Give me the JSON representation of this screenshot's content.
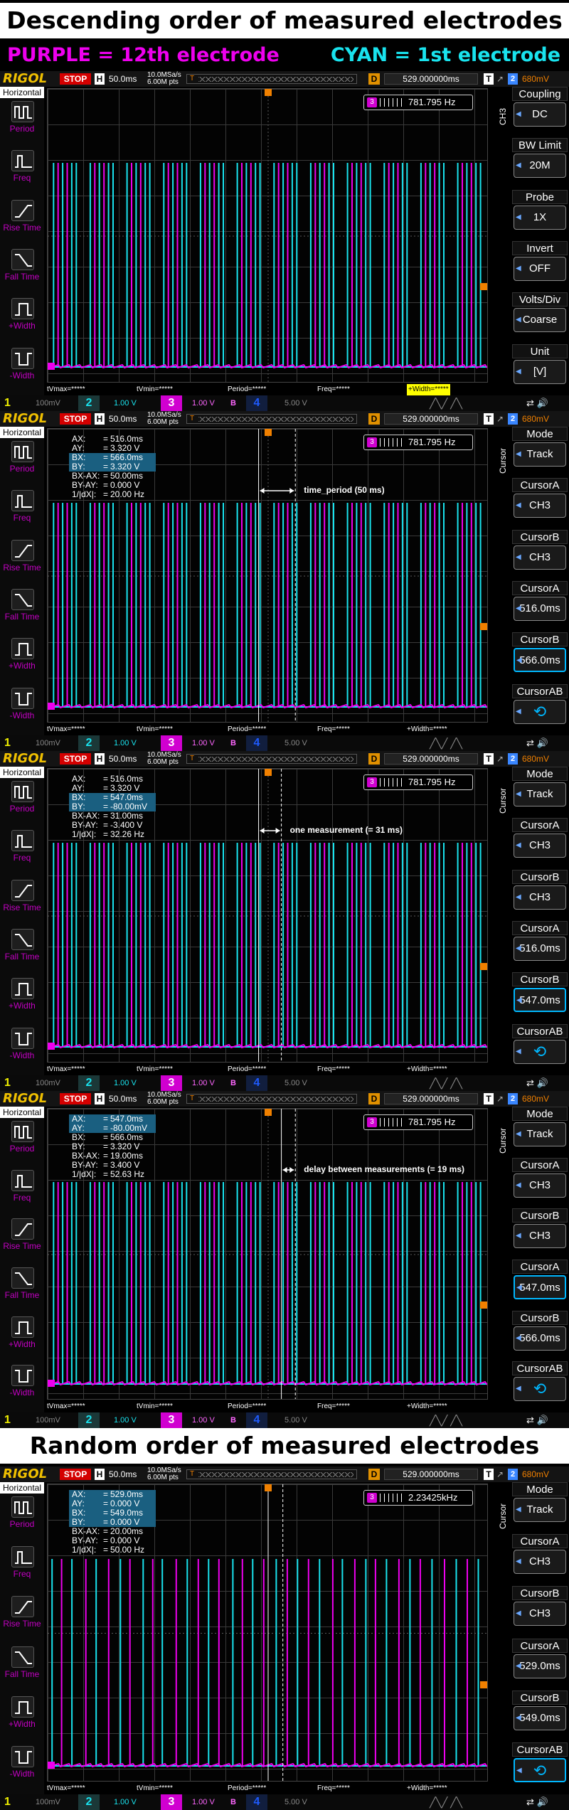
{
  "headings": {
    "descending": "Descending order of measured electrodes",
    "random": "Random order of measured electrodes"
  },
  "legend": {
    "purple": "PURPLE = 12th electrode",
    "cyan": "CYAN = 1st electrode"
  },
  "colors": {
    "purple": "#ee00ee",
    "cyan": "#19e3ee",
    "rigol_yellow": "#f0c000",
    "stop_red": "#d40000",
    "cursor_blue": "#00b8ff"
  },
  "scopes": [
    {
      "brand": "RIGOL",
      "run_state": "STOP",
      "h_label": "H",
      "timebase": "50.0ms",
      "sample_rate": "10.0MSa/s",
      "points": "6.00M pts",
      "trig_mark": "T",
      "d_label": "D",
      "delay": "529.000000ms",
      "t_label": "T",
      "trig_ch": "2",
      "trig_level": "680mV",
      "freq": "781.795 Hz",
      "freq_icon": "3",
      "left_menu": {
        "title": "Horizontal",
        "items": [
          "Period",
          "Freq",
          "Rise Time",
          "Fall Time",
          "+Width",
          "-Width"
        ]
      },
      "bottom_meas": [
        "tVmax=*****",
        "tVmin=*****",
        "Period=*****",
        "Freq=*****",
        "+Width=*****"
      ],
      "bottom_highlight": 4,
      "right_menu": {
        "vertical_label": "CH3",
        "items": [
          {
            "head": "Coupling",
            "value": "DC"
          },
          {
            "head": "BW Limit",
            "value": "20M"
          },
          {
            "head": "Probe",
            "value": "1X"
          },
          {
            "head": "Invert",
            "value": "OFF"
          },
          {
            "head": "Volts/Div",
            "value": "Coarse"
          },
          {
            "head": "Unit",
            "value": "[V]"
          }
        ]
      },
      "cursor_rows": [],
      "annotation": "",
      "cursor_a_t": null,
      "cursor_b_t": null,
      "channel_bar": {
        "ch1": "1",
        "ch1_val": "100mV",
        "ch2": "2",
        "ch2_val": "1.00 V",
        "ch3": "3",
        "ch3_val": "1.00 V",
        "bw": "B",
        "ch4": "4",
        "ch4_val": "5.00 V"
      },
      "pattern": "desc"
    },
    {
      "brand": "RIGOL",
      "run_state": "STOP",
      "h_label": "H",
      "timebase": "50.0ms",
      "sample_rate": "10.0MSa/s",
      "points": "6.00M pts",
      "trig_mark": "T",
      "d_label": "D",
      "delay": "529.000000ms",
      "t_label": "T",
      "trig_ch": "2",
      "trig_level": "680mV",
      "freq": "781.795 Hz",
      "freq_icon": "3",
      "left_menu": {
        "title": "Horizontal",
        "items": [
          "Period",
          "Freq",
          "Rise Time",
          "Fall Time",
          "+Width",
          "-Width"
        ]
      },
      "bottom_meas": [
        "tVmax=*****",
        "tVmin=*****",
        "Period=*****",
        "Freq=*****",
        "+Width=*****"
      ],
      "bottom_highlight": -1,
      "right_menu": {
        "vertical_label": "Cursor",
        "items": [
          {
            "head": "Mode",
            "value": "Track"
          },
          {
            "head": "CursorA",
            "value": "CH3"
          },
          {
            "head": "CursorB",
            "value": "CH3"
          },
          {
            "head": "CursorA",
            "value": "516.0ms"
          },
          {
            "head": "CursorB",
            "value": "566.0ms",
            "selected": true
          },
          {
            "head": "CursorAB",
            "value": "⟲",
            "rot": true
          }
        ]
      },
      "cursor_rows": [
        {
          "k": "AX:",
          "v": "516.0ms"
        },
        {
          "k": "AY:",
          "v": "3.320 V"
        },
        {
          "k": "BX:",
          "v": "566.0ms",
          "hi": true
        },
        {
          "k": "BY:",
          "v": "3.320 V",
          "hi": true
        },
        {
          "k": "BX-AX:",
          "v": "50.00ms"
        },
        {
          "k": "BY-AY:",
          "v": "0.000 V"
        },
        {
          "k": "1/|dX|:",
          "v": "20.00 Hz"
        }
      ],
      "annotation": "time_period (50 ms)",
      "cursor_a_t": 516,
      "cursor_b_t": 566,
      "channel_bar": {
        "ch1": "1",
        "ch1_val": "100mV",
        "ch2": "2",
        "ch2_val": "1.00 V",
        "ch3": "3",
        "ch3_val": "1.00 V",
        "bw": "B",
        "ch4": "4",
        "ch4_val": "5.00 V"
      },
      "pattern": "desc"
    },
    {
      "brand": "RIGOL",
      "run_state": "STOP",
      "h_label": "H",
      "timebase": "50.0ms",
      "sample_rate": "10.0MSa/s",
      "points": "6.00M pts",
      "trig_mark": "T",
      "d_label": "D",
      "delay": "529.000000ms",
      "t_label": "T",
      "trig_ch": "2",
      "trig_level": "680mV",
      "freq": "781.795 Hz",
      "freq_icon": "3",
      "left_menu": {
        "title": "Horizontal",
        "items": [
          "Period",
          "Freq",
          "Rise Time",
          "Fall Time",
          "+Width",
          "-Width"
        ]
      },
      "bottom_meas": [
        "tVmax=*****",
        "tVmin=*****",
        "Period=*****",
        "Freq=*****",
        "+Width=*****"
      ],
      "bottom_highlight": -1,
      "right_menu": {
        "vertical_label": "Cursor",
        "items": [
          {
            "head": "Mode",
            "value": "Track"
          },
          {
            "head": "CursorA",
            "value": "CH3"
          },
          {
            "head": "CursorB",
            "value": "CH3"
          },
          {
            "head": "CursorA",
            "value": "516.0ms"
          },
          {
            "head": "CursorB",
            "value": "547.0ms",
            "selected": true
          },
          {
            "head": "CursorAB",
            "value": "⟲",
            "rot": true
          }
        ]
      },
      "cursor_rows": [
        {
          "k": "AX:",
          "v": "516.0ms"
        },
        {
          "k": "AY:",
          "v": "3.320 V"
        },
        {
          "k": "BX:",
          "v": "547.0ms",
          "hi": true
        },
        {
          "k": "BY:",
          "v": "-80.00mV",
          "hi": true
        },
        {
          "k": "BX-AX:",
          "v": "31.00ms"
        },
        {
          "k": "BY-AY:",
          "v": "-3.400 V"
        },
        {
          "k": "1/|dX|:",
          "v": "32.26 Hz"
        }
      ],
      "annotation": "one measurement (= 31 ms)",
      "cursor_a_t": 516,
      "cursor_b_t": 547,
      "channel_bar": {
        "ch1": "1",
        "ch1_val": "100mV",
        "ch2": "2",
        "ch2_val": "1.00 V",
        "ch3": "3",
        "ch3_val": "1.00 V",
        "bw": "B",
        "ch4": "4",
        "ch4_val": "5.00 V"
      },
      "pattern": "desc"
    },
    {
      "brand": "RIGOL",
      "run_state": "STOP",
      "h_label": "H",
      "timebase": "50.0ms",
      "sample_rate": "10.0MSa/s",
      "points": "6.00M pts",
      "trig_mark": "T",
      "d_label": "D",
      "delay": "529.000000ms",
      "t_label": "T",
      "trig_ch": "2",
      "trig_level": "680mV",
      "freq": "781.795 Hz",
      "freq_icon": "3",
      "left_menu": {
        "title": "Horizontal",
        "items": [
          "Period",
          "Freq",
          "Rise Time",
          "Fall Time",
          "+Width",
          "-Width"
        ]
      },
      "bottom_meas": [
        "tVmax=*****",
        "tVmin=*****",
        "Period=*****",
        "Freq=*****",
        "+Width=*****"
      ],
      "bottom_highlight": -1,
      "right_menu": {
        "vertical_label": "Cursor",
        "items": [
          {
            "head": "Mode",
            "value": "Track"
          },
          {
            "head": "CursorA",
            "value": "CH3"
          },
          {
            "head": "CursorB",
            "value": "CH3"
          },
          {
            "head": "CursorA",
            "value": "547.0ms",
            "selected": true
          },
          {
            "head": "CursorB",
            "value": "566.0ms"
          },
          {
            "head": "CursorAB",
            "value": "⟲",
            "rot": true
          }
        ]
      },
      "cursor_rows": [
        {
          "k": "AX:",
          "v": "547.0ms",
          "hi": true
        },
        {
          "k": "AY:",
          "v": "-80.00mV",
          "hi": true
        },
        {
          "k": "BX:",
          "v": "566.0ms"
        },
        {
          "k": "BY:",
          "v": "3.320 V"
        },
        {
          "k": "BX-AX:",
          "v": "19.00ms"
        },
        {
          "k": "BY-AY:",
          "v": "3.400 V"
        },
        {
          "k": "1/|dX|:",
          "v": "52.63 Hz"
        }
      ],
      "annotation": "delay between measurements (= 19 ms)",
      "cursor_a_t": 547,
      "cursor_b_t": 566,
      "channel_bar": {
        "ch1": "1",
        "ch1_val": "100mV",
        "ch2": "2",
        "ch2_val": "1.00 V",
        "ch3": "3",
        "ch3_val": "1.00 V",
        "bw": "B",
        "ch4": "4",
        "ch4_val": "5.00 V"
      },
      "pattern": "desc"
    },
    {
      "brand": "RIGOL",
      "run_state": "STOP",
      "h_label": "H",
      "timebase": "50.0ms",
      "sample_rate": "10.0MSa/s",
      "points": "6.00M pts",
      "trig_mark": "T",
      "d_label": "D",
      "delay": "529.000000ms",
      "t_label": "T",
      "trig_ch": "2",
      "trig_level": "680mV",
      "freq": "2.23425kHz",
      "freq_icon": "3",
      "left_menu": {
        "title": "Horizontal",
        "items": [
          "Period",
          "Freq",
          "Rise Time",
          "Fall Time",
          "+Width",
          "-Width"
        ]
      },
      "bottom_meas": [
        "tVmax=*****",
        "tVmin=*****",
        "Period=*****",
        "Freq=*****",
        "+Width=*****"
      ],
      "bottom_highlight": -1,
      "right_menu": {
        "vertical_label": "Cursor",
        "items": [
          {
            "head": "Mode",
            "value": "Track"
          },
          {
            "head": "CursorA",
            "value": "CH3"
          },
          {
            "head": "CursorB",
            "value": "CH3"
          },
          {
            "head": "CursorA",
            "value": "529.0ms"
          },
          {
            "head": "CursorB",
            "value": "549.0ms"
          },
          {
            "head": "CursorAB",
            "value": "⟲",
            "rot": true,
            "selected": true
          }
        ]
      },
      "cursor_rows": [
        {
          "k": "AX:",
          "v": "529.0ms",
          "hi": true
        },
        {
          "k": "AY:",
          "v": "0.000 V",
          "hi": true
        },
        {
          "k": "BX:",
          "v": "549.0ms",
          "hi": true
        },
        {
          "k": "BY:",
          "v": "0.000 V",
          "hi": true
        },
        {
          "k": "BX-AX:",
          "v": "20.00ms"
        },
        {
          "k": "BY-AY:",
          "v": "0.000 V"
        },
        {
          "k": "1/|dX|:",
          "v": "50.00 Hz"
        }
      ],
      "annotation": "",
      "cursor_a_t": 529,
      "cursor_b_t": 549,
      "channel_bar": {
        "ch1": "1",
        "ch1_val": "100mV",
        "ch2": "2",
        "ch2_val": "1.00 V",
        "ch3": "3",
        "ch3_val": "1.00 V",
        "bw": "B",
        "ch4": "4",
        "ch4_val": "5.00 V"
      },
      "pattern": "random"
    }
  ]
}
